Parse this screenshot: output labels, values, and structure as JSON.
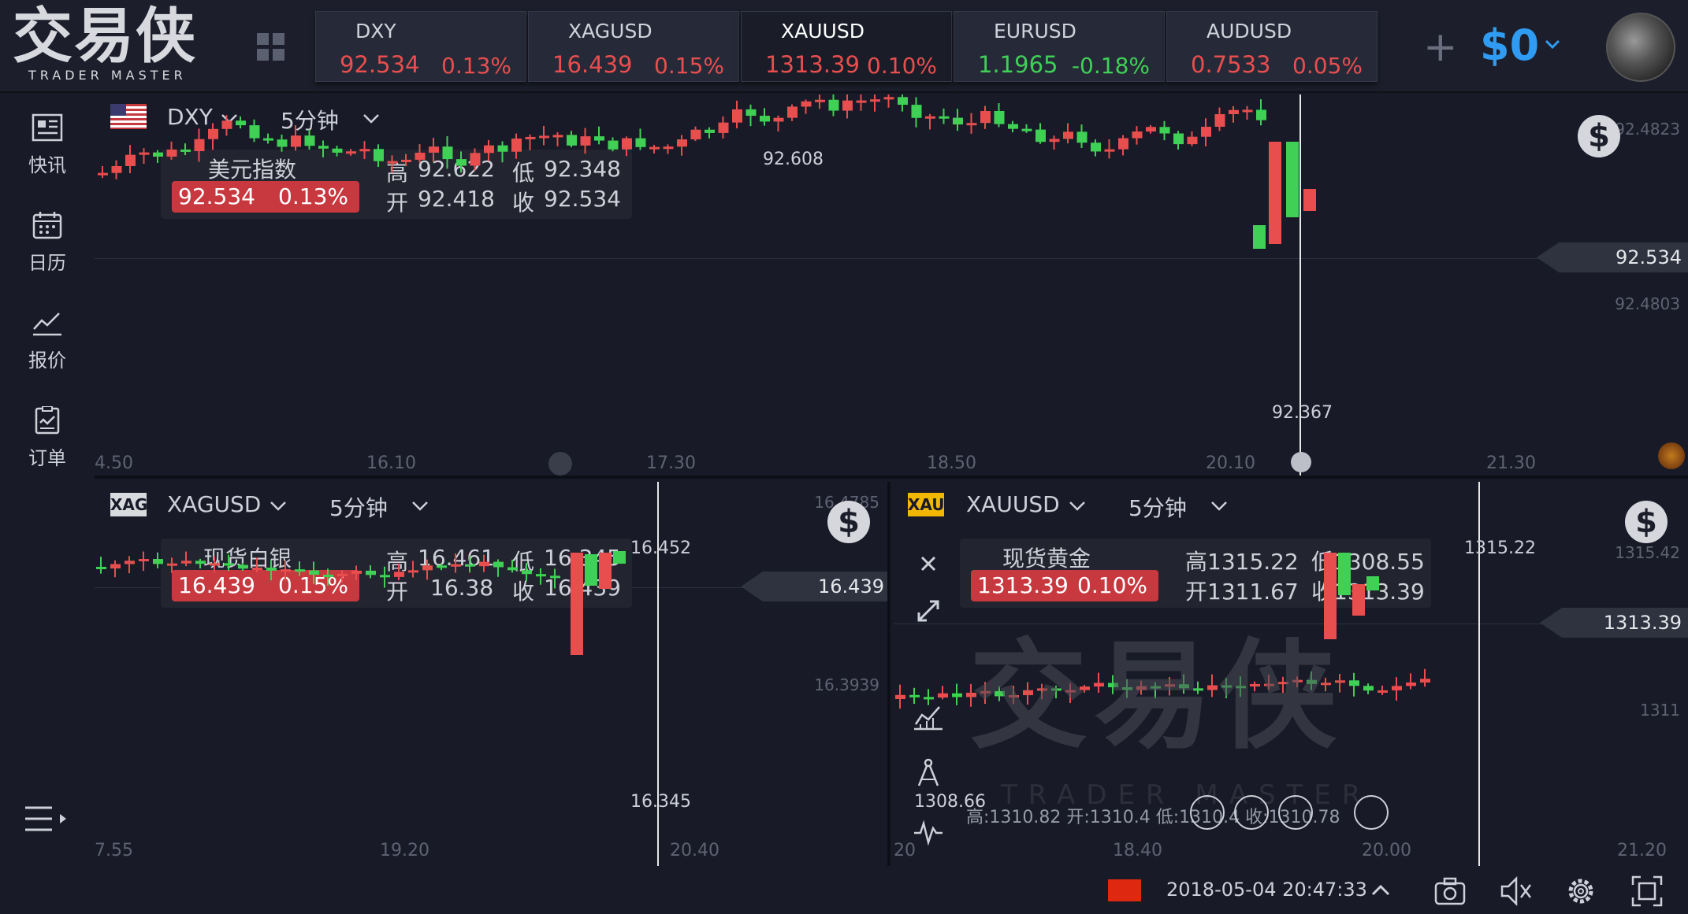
{
  "app": {
    "logo": "交易侠",
    "logo_sub": "TRADER MASTER"
  },
  "tickers": [
    {
      "symbol": "DXY",
      "price": "92.534",
      "change": "0.13%",
      "dir": "up"
    },
    {
      "symbol": "XAGUSD",
      "price": "16.439",
      "change": "0.15%",
      "dir": "up"
    },
    {
      "symbol": "XAUUSD",
      "price": "1313.39",
      "change": "0.10%",
      "dir": "up"
    },
    {
      "symbol": "EURUSD",
      "price": "1.1965",
      "change": "-0.18%",
      "dir": "down"
    },
    {
      "symbol": "AUDUSD",
      "price": "0.7533",
      "change": "0.05%",
      "dir": "up"
    }
  ],
  "account": {
    "plus": "+",
    "balance": "$0"
  },
  "sidebar": {
    "items": [
      {
        "label": "快讯",
        "icon": "news-icon"
      },
      {
        "label": "日历",
        "icon": "calendar-icon"
      },
      {
        "label": "报价",
        "icon": "quotes-chart-icon"
      },
      {
        "label": "订单",
        "icon": "orders-icon"
      }
    ]
  },
  "panes": {
    "dxy": {
      "symbol": "DXY",
      "interval": "5分钟",
      "name": "美元指数",
      "price": "92.534",
      "change": "0.13%",
      "high_label": "高",
      "high": "92.622",
      "low_label": "低",
      "low": "92.348",
      "open_label": "开",
      "open": "92.418",
      "close_label": "收",
      "close": "92.534",
      "current_price": "92.534",
      "y_labels": [
        "92.4823",
        "92.4803"
      ],
      "x_labels": [
        "4.50",
        "16.10",
        "17.30",
        "18.50",
        "20.10",
        "21.30"
      ],
      "hi_note": "92.608",
      "lo_note": "92.367"
    },
    "xag": {
      "badge": "XAG",
      "symbol": "XAGUSD",
      "interval": "5分钟",
      "name": "现货白银",
      "price": "16.439",
      "change": "0.15%",
      "high_label": "高",
      "high": "16.461",
      "low_label": "低",
      "low": "16.345",
      "open_label": "开",
      "open": "16.38",
      "close_label": "收",
      "close": "16.439",
      "current_price": "16.439",
      "y_labels": [
        "16.4785",
        "16.3939"
      ],
      "x_labels": [
        "7.55",
        "19.20",
        "20.40"
      ],
      "hi_note": "16.452",
      "lo_note": "16.345"
    },
    "xau": {
      "badge": "XAU",
      "symbol": "XAUUSD",
      "interval": "5分钟",
      "name": "现货黄金",
      "price": "1313.39",
      "change": "0.10%",
      "high": "高1315.22",
      "low": "低1308.55",
      "open": "开1311.67",
      "close": "收1313.39",
      "current_price": "1313.39",
      "y_labels": [
        "1315.42",
        "1311"
      ],
      "x_labels": [
        "20",
        "18.40",
        "20.00",
        "21.20"
      ],
      "hi_note": "1315.22",
      "lo_note": "1308.66",
      "hud": "高:1310.82 开:1310.4 低:1310.4 收:1310.78"
    }
  },
  "watermark": {
    "big": "交易侠",
    "small": "TRADER MASTER"
  },
  "status": {
    "datetime": "2018-05-04 20:47:33"
  },
  "colors": {
    "up": "#e84e4e",
    "down": "#3fd055",
    "accent": "#2f9bf2",
    "badge": "#c8383f"
  }
}
